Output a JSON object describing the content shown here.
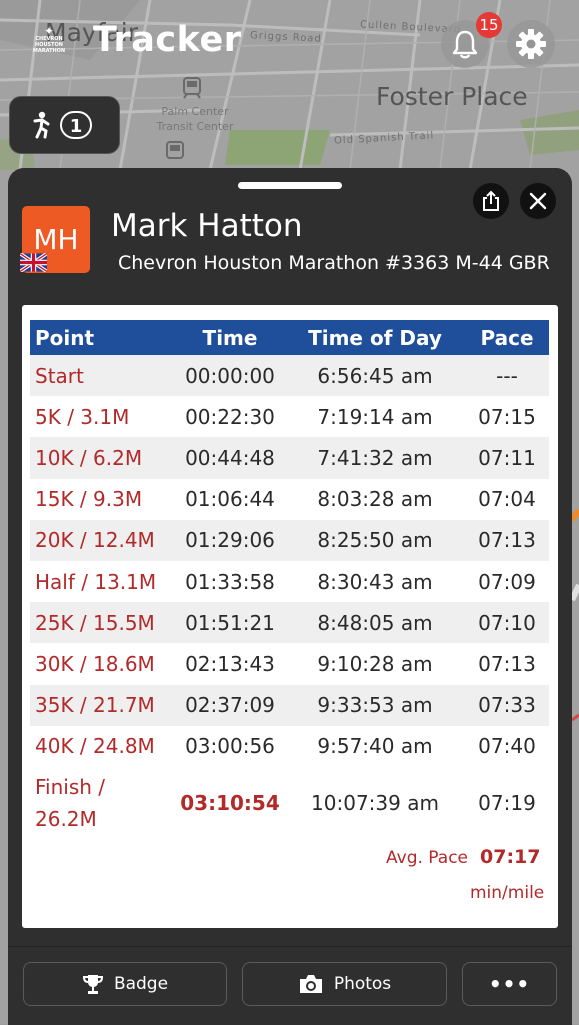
{
  "header": {
    "title": "Tracker",
    "logo_text": "CHEVRON HOUSTON MARATHON",
    "notification_count": "15"
  },
  "map": {
    "labels": [
      "Mayfair",
      "Foster Place",
      "Palm Center Transit Center",
      "Old Spanish Trail",
      "Griggs Road",
      "Cullen Boulevard"
    ]
  },
  "follow": {
    "count": "1"
  },
  "athlete": {
    "initials": "MH",
    "name": "Mark Hatton",
    "subtitle": "Chevron Houston Marathon #3363 M-44 GBR",
    "country_flag": "uk-flag-icon"
  },
  "splits": {
    "headers": [
      "Point",
      "Time",
      "Time of Day",
      "Pace"
    ],
    "rows": [
      [
        "Start",
        "00:00:00",
        "6:56:45 am",
        "---"
      ],
      [
        "5K / 3.1M",
        "00:22:30",
        "7:19:14 am",
        "07:15"
      ],
      [
        "10K / 6.2M",
        "00:44:48",
        "7:41:32 am",
        "07:11"
      ],
      [
        "15K / 9.3M",
        "01:06:44",
        "8:03:28 am",
        "07:04"
      ],
      [
        "20K / 12.4M",
        "01:29:06",
        "8:25:50 am",
        "07:13"
      ],
      [
        "Half / 13.1M",
        "01:33:58",
        "8:30:43 am",
        "07:09"
      ],
      [
        "25K / 15.5M",
        "01:51:21",
        "8:48:05 am",
        "07:10"
      ],
      [
        "30K / 18.6M",
        "02:13:43",
        "9:10:28 am",
        "07:13"
      ],
      [
        "35K / 21.7M",
        "02:37:09",
        "9:33:53 am",
        "07:33"
      ],
      [
        "40K / 24.8M",
        "03:00:56",
        "9:57:40 am",
        "07:40"
      ]
    ],
    "finish": {
      "point_line1": "Finish /",
      "point_line2": "26.2M",
      "time": "03:10:54",
      "time_of_day": "10:07:39 am",
      "pace": "07:19"
    },
    "avg_pace_label": "Avg. Pace",
    "avg_pace_value": "07:17",
    "avg_pace_unit": "min/mile"
  },
  "actions": {
    "badge_label": "Badge",
    "photos_label": "Photos",
    "more_label": "•••"
  },
  "colors": {
    "accent_red": "#b22a2a",
    "header_blue": "#1f4e9a",
    "avatar_orange": "#ee5a24",
    "badge_red": "#e53935"
  }
}
